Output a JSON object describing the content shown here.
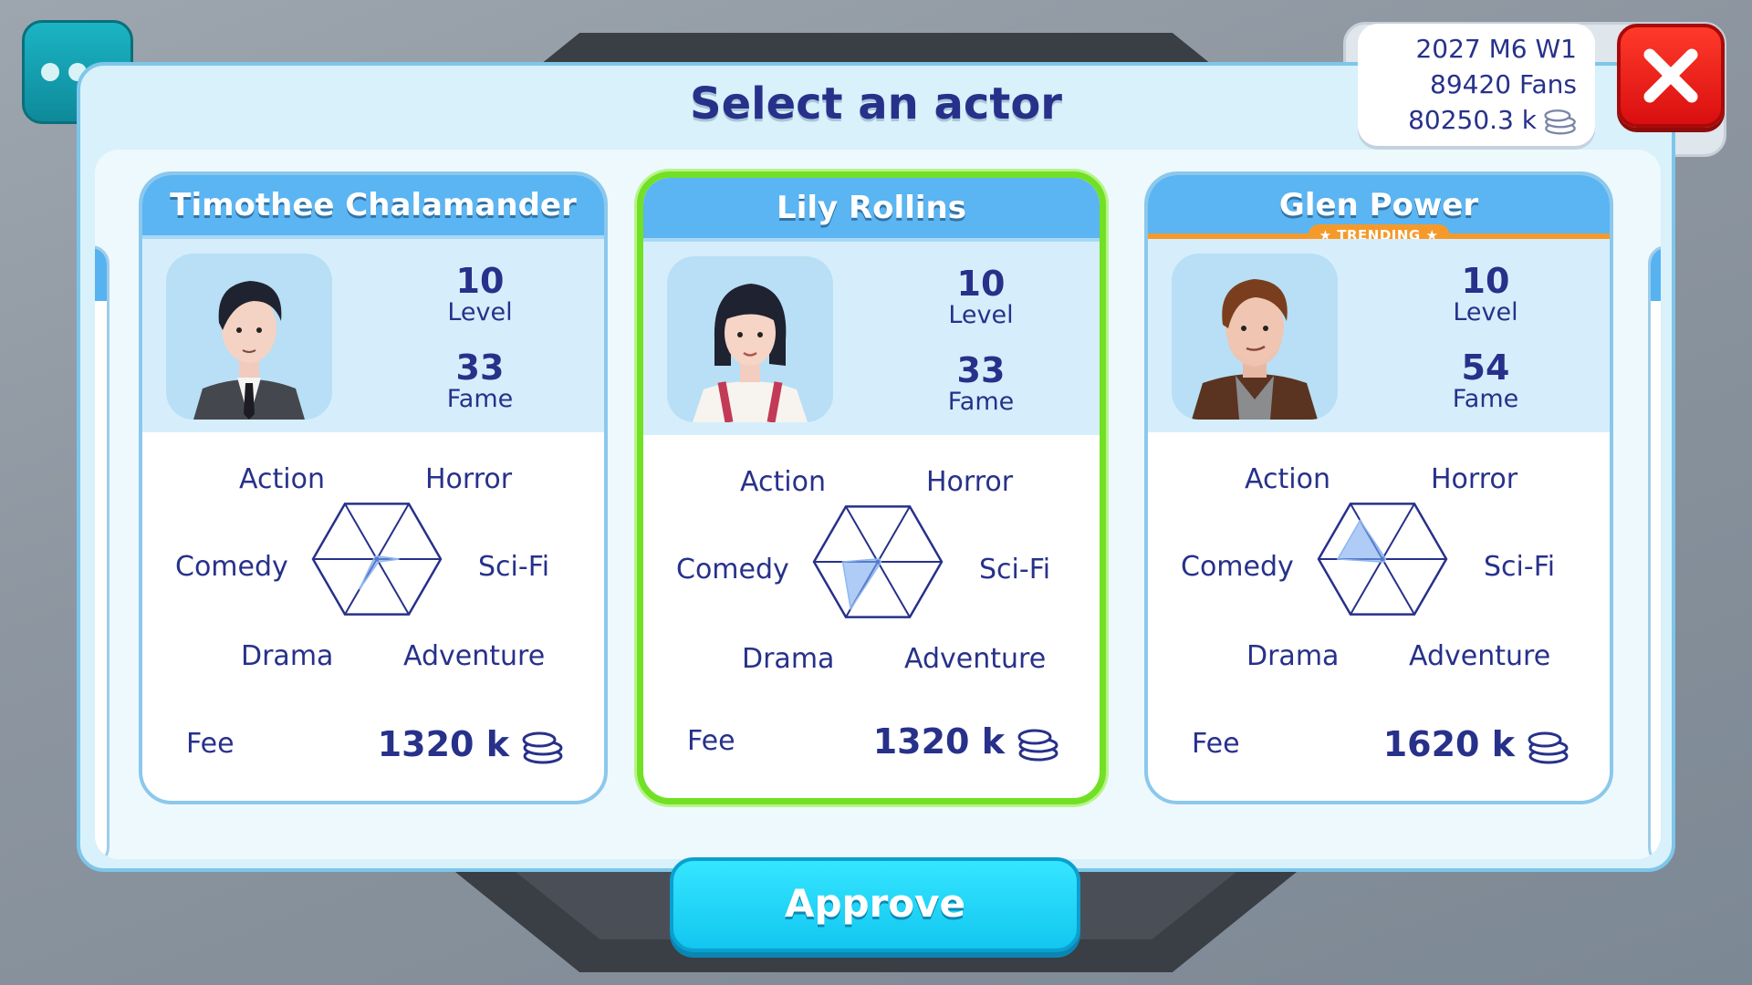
{
  "modal": {
    "title": "Select an actor"
  },
  "stats": {
    "date": "2027 M6 W1",
    "fans": "89420 Fans",
    "money": "80250.3 k"
  },
  "approve_label": "Approve",
  "labels": {
    "level": "Level",
    "fame": "Fame",
    "fee": "Fee"
  },
  "genres": [
    "Action",
    "Horror",
    "Comedy",
    "Sci-Fi",
    "Drama",
    "Adventure"
  ],
  "actors": [
    {
      "name": "Timothee Chalamander",
      "level": "10",
      "fame": "33",
      "fee": "1320 k",
      "trending": false,
      "selected": false,
      "skills": [
        0.05,
        0.05,
        0.05,
        0.35,
        0.55,
        0.05
      ]
    },
    {
      "name": "Lily Rollins",
      "level": "10",
      "fame": "33",
      "fee": "1320 k",
      "trending": false,
      "selected": true,
      "skills": [
        0.05,
        0.05,
        0.55,
        0.05,
        0.85,
        0.05
      ]
    },
    {
      "name": "Glen Power",
      "level": "10",
      "fame": "54",
      "fee": "1620 k",
      "trending": true,
      "trending_label": "★ TRENDING ★",
      "selected": false,
      "skills": [
        0.7,
        0.05,
        0.7,
        0.05,
        0.05,
        0.05
      ]
    }
  ],
  "colors": {
    "accent": "#5ab5f2",
    "text": "#27318a",
    "selected": "#72e024",
    "trending": "#f59a2a",
    "approve": "#12c6f0",
    "close": "#e81a14"
  },
  "icons": {
    "menu": "more-dots-icon",
    "close": "close-x-icon",
    "coin": "coin-stack-icon"
  }
}
